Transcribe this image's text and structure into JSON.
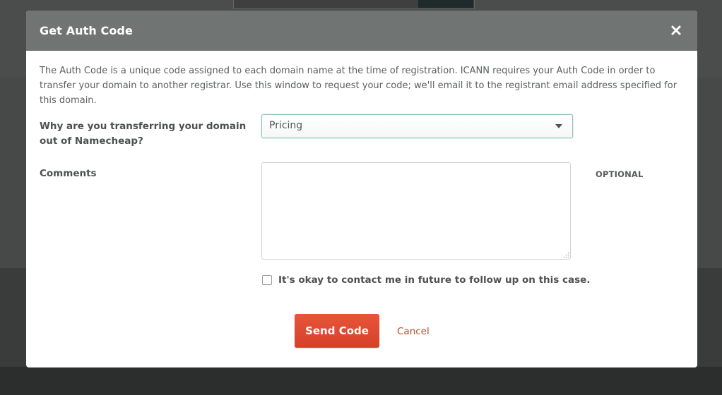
{
  "modal": {
    "title": "Get Auth Code",
    "description": "The Auth Code is a unique code assigned to each domain name at the time of registration. ICANN requires your Auth Code in order to transfer your domain to another registrar. Use this window to request your code; we'll email it to the registrant email address specified for this domain.",
    "close_icon": "close-icon"
  },
  "form": {
    "reason_label": "Why are you transferring your domain out of Namecheap?",
    "reason_value": "Pricing",
    "comments_label": "Comments",
    "comments_value": "",
    "optional_tag": "OPTIONAL",
    "contact_checkbox_label": "It's okay to contact me in future to follow up on this case.",
    "contact_checked": false
  },
  "actions": {
    "send_label": "Send Code",
    "cancel_label": "Cancel"
  },
  "colors": {
    "header_bg": "#707574",
    "primary_button": "#e04b32",
    "cancel_link": "#c9432d",
    "select_focus_border": "#8cc5b8"
  }
}
